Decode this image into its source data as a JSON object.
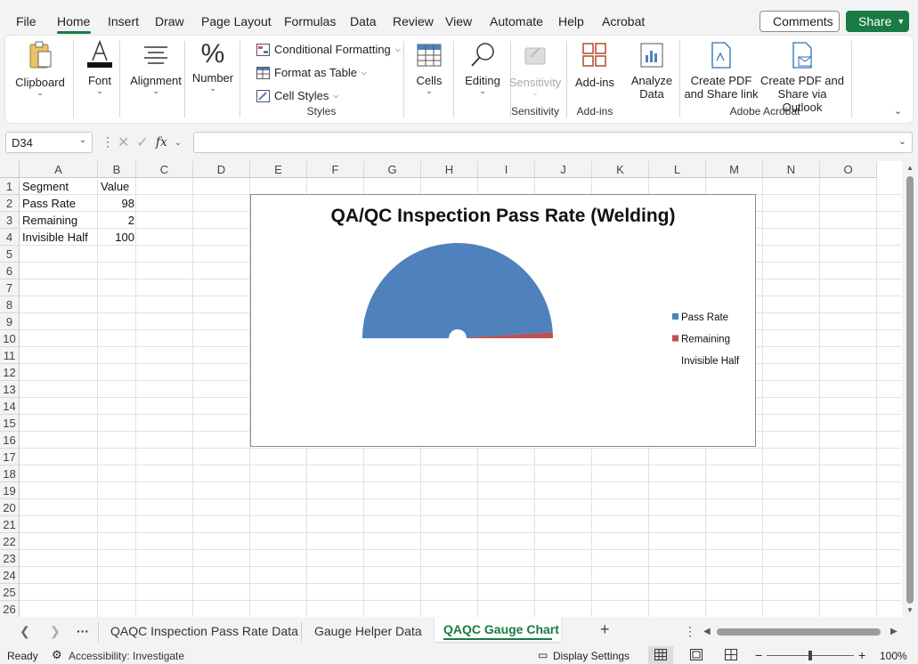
{
  "menu": {
    "tabs": [
      "File",
      "Home",
      "Insert",
      "Draw",
      "Page Layout",
      "Formulas",
      "Data",
      "Review",
      "View",
      "Automate",
      "Help",
      "Acrobat"
    ],
    "comments_label": "Comments",
    "share_label": "Share"
  },
  "ribbon": {
    "clipboard": "Clipboard",
    "font": "Font",
    "alignment": "Alignment",
    "number": "Number",
    "conditional_formatting": "Conditional Formatting",
    "format_as_table": "Format as Table",
    "cell_styles": "Cell Styles",
    "styles_group": "Styles",
    "cells": "Cells",
    "editing": "Editing",
    "sensitivity": "Sensitivity",
    "sensitivity_group": "Sensitivity",
    "addins": "Add-ins",
    "addins_group": "Add-ins",
    "analyze_1": "Analyze",
    "analyze_2": "Data",
    "pdf_link_1": "Create PDF",
    "pdf_link_2": "and Share link",
    "pdf_outlook_1": "Create PDF and",
    "pdf_outlook_2": "Share via Outlook",
    "acrobat_group": "Adobe Acrobat"
  },
  "formula_bar": {
    "name_box": "D34",
    "fx": "fx",
    "value": ""
  },
  "grid": {
    "columns": [
      "A",
      "B",
      "C",
      "D",
      "E",
      "F",
      "G",
      "H",
      "I",
      "J",
      "K",
      "L",
      "M",
      "N",
      "O"
    ],
    "rows": [
      "1",
      "2",
      "3",
      "4",
      "5",
      "6",
      "7",
      "8",
      "9",
      "10",
      "11",
      "12",
      "13",
      "14",
      "15",
      "16",
      "17",
      "18",
      "19",
      "20",
      "21",
      "22",
      "23",
      "24",
      "25",
      "26"
    ],
    "cells": {
      "a1": "Segment",
      "b1": "Value",
      "a2": "Pass Rate",
      "b2": "98",
      "a3": "Remaining",
      "b3": "2",
      "a4": "Invisible Half",
      "b4": "100"
    }
  },
  "chart_data": {
    "type": "pie",
    "title": "QA/QC Inspection Pass Rate (Welding)",
    "categories": [
      "Pass Rate",
      "Remaining",
      "Invisible Half"
    ],
    "values": [
      98,
      2,
      100
    ],
    "colors": [
      "#4f81bd",
      "#c0504d",
      "none"
    ],
    "legend_position": "right",
    "start_angle": 270,
    "hole": true
  },
  "sheet_tabs": [
    "QAQC Inspection Pass Rate Data",
    "Gauge Helper Data",
    "QAQC Gauge Chart"
  ],
  "active_sheet": "QAQC Gauge Chart",
  "status": {
    "ready": "Ready",
    "accessibility": "Accessibility: Investigate",
    "display_settings": "Display Settings",
    "zoom": "100%"
  }
}
